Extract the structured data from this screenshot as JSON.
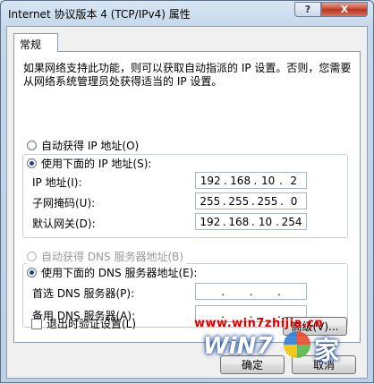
{
  "window": {
    "title": "Internet 协议版本 4 (TCP/IPv4) 属性",
    "help": "?",
    "close": "X"
  },
  "tabs": [
    {
      "label": "常规"
    }
  ],
  "description": "如果网络支持此功能，则可以获取自动指派的 IP 设置。否则，您需要从网络系统管理员处获得适当的 IP 设置。",
  "ip": {
    "auto_label": "自动获得 IP 地址(O)",
    "manual_label": "使用下面的 IP 地址(S):",
    "selected": "manual",
    "fields": [
      {
        "label": "IP 地址(I):",
        "octets": [
          "192",
          "168",
          "10",
          "2"
        ]
      },
      {
        "label": "子网掩码(U):",
        "octets": [
          "255",
          "255",
          "255",
          "0"
        ]
      },
      {
        "label": "默认网关(D):",
        "octets": [
          "192",
          "168",
          "10",
          "254"
        ]
      }
    ]
  },
  "dns": {
    "auto_label": "自动获得 DNS 服务器地址(B)",
    "manual_label": "使用下面的 DNS 服务器地址(E):",
    "selected": "manual",
    "fields": [
      {
        "label": "首选 DNS 服务器(P):",
        "octets": [
          "",
          "",
          "",
          ""
        ]
      },
      {
        "label": "备用 DNS 服务器(A):",
        "octets": [
          "",
          "",
          "",
          ""
        ]
      }
    ]
  },
  "validate_on_exit": {
    "label": "退出时验证设置(L)",
    "checked": false
  },
  "buttons": {
    "advanced": "高级(V)...",
    "ok": "确定",
    "cancel": "取消"
  },
  "watermark": {
    "url": "www.win7zhijia.cn",
    "logo": "WiN7",
    "suffix": "家"
  }
}
